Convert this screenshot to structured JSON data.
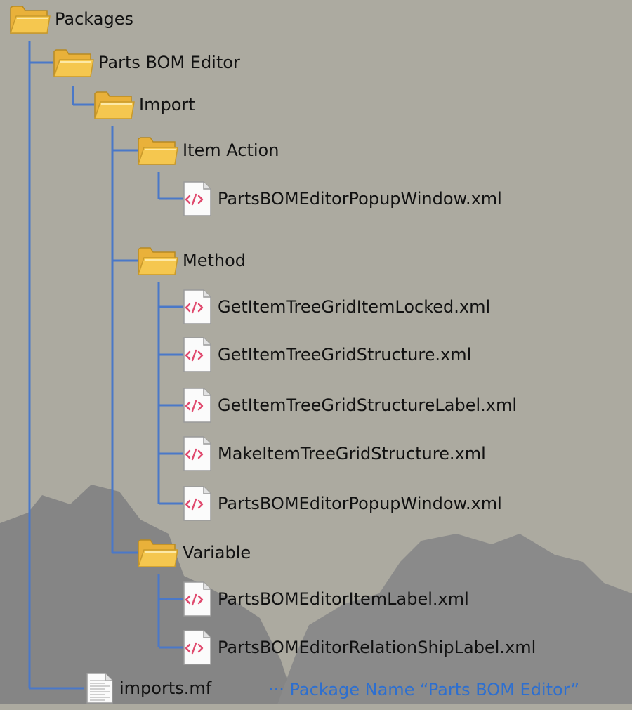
{
  "tree": {
    "root": {
      "label": "Packages",
      "icon": "folder-icon"
    },
    "package": {
      "label": "Parts BOM Editor",
      "icon": "folder-icon"
    },
    "import": {
      "label": "Import",
      "icon": "folder-icon"
    },
    "item_action": {
      "label": "Item Action",
      "icon": "folder-icon",
      "files": [
        "PartsBOMEditorPopupWindow.xml"
      ]
    },
    "method": {
      "label": "Method",
      "icon": "folder-icon",
      "files": [
        "GetItemTreeGridItemLocked.xml",
        "GetItemTreeGridStructure.xml",
        "GetItemTreeGridStructureLabel.xml",
        "MakeItemTreeGridStructure.xml",
        "PartsBOMEditorPopupWindow.xml"
      ]
    },
    "variable": {
      "label": "Variable",
      "icon": "folder-icon",
      "files": [
        "PartsBOMEditorItemLabel.xml",
        "PartsBOMEditorRelationShipLabel.xml"
      ]
    },
    "manifest": {
      "label": "imports.mf",
      "icon": "document-icon"
    }
  },
  "note": "··· Package Name “Parts BOM Editor”",
  "colors": {
    "background": "#acaaa0",
    "gear": "#858585",
    "connector": "#4a78c8",
    "note": "#2d6fd0",
    "folder": "#f5c74f",
    "xml_tag": "#e04a6e"
  }
}
